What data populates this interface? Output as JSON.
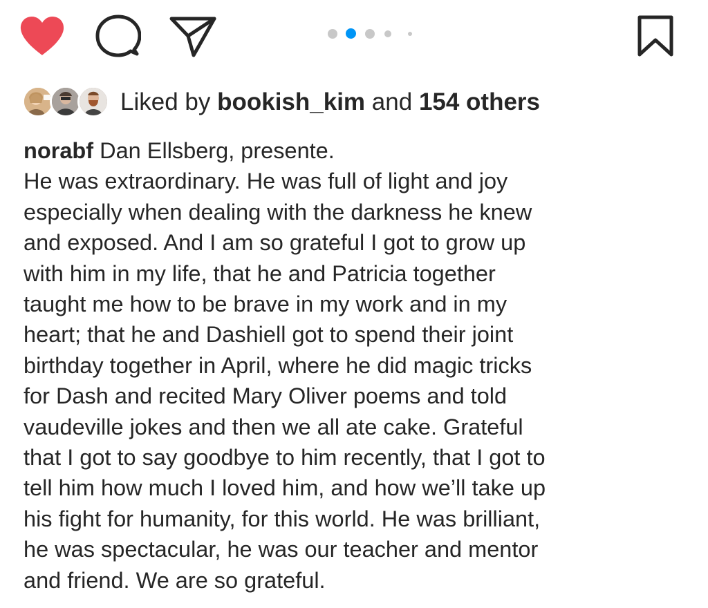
{
  "actions": {
    "like_icon": "heart-icon",
    "like_color": "#ED4956",
    "comment_icon": "comment-icon",
    "share_icon": "share-icon",
    "save_icon": "bookmark-icon"
  },
  "carousel": {
    "total_dots": 5,
    "active_index": 1,
    "active_color": "#0095F6",
    "inactive_color": "#C8C8C8"
  },
  "likes": {
    "prefix": "Liked by",
    "user": "bookish_kim",
    "joiner": "and",
    "others": "154 others"
  },
  "caption": {
    "username": "norabf",
    "first_line": "Dan Ellsberg, presente.",
    "lines": [
      "He was extraordinary. He was full of light and joy",
      "especially when dealing with the darkness he knew",
      "and exposed. And I am so grateful I got to grow up",
      "with him in my life, that he and Patricia together",
      "taught me how to be brave in my work and in my",
      "heart; that he and Dashiell got to spend their joint",
      "birthday together in April, where he did magic tricks",
      "for Dash and recited Mary Oliver poems and told",
      "vaudeville jokes and then we all ate cake. Grateful",
      "that I got to say goodbye to him recently, that I got to",
      "tell him how much I loved him, and how we’ll take up",
      "his fight for humanity, for this world. He was brilliant,",
      "he was spectacular, he was our teacher and mentor",
      "and friend. We are so grateful."
    ]
  }
}
